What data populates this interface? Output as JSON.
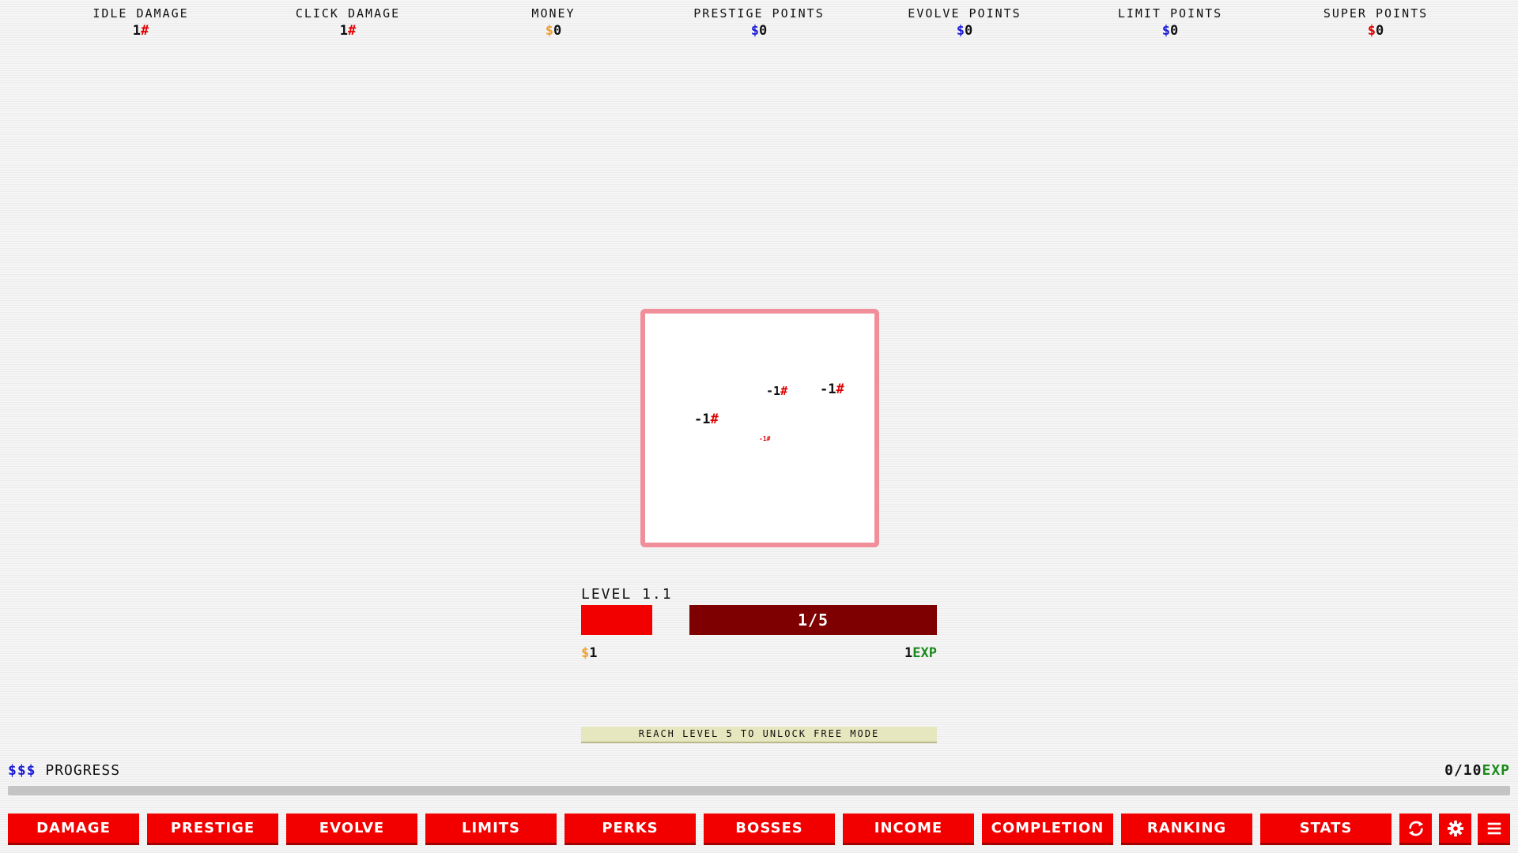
{
  "stats": [
    {
      "label": "IDLE DAMAGE",
      "value": "1",
      "symbol": "#",
      "symbol_color": "#e00000"
    },
    {
      "label": "CLICK DAMAGE",
      "value": "1",
      "symbol": "#",
      "symbol_color": "#e00000"
    },
    {
      "label": "MONEY",
      "value": "0",
      "symbol": "$",
      "symbol_color": "#f0a030"
    },
    {
      "label": "PRESTIGE POINTS",
      "value": "0",
      "symbol": "$",
      "symbol_color": "#1a1ad6"
    },
    {
      "label": "EVOLVE POINTS",
      "value": "0",
      "symbol": "$",
      "symbol_color": "#1a1ad6"
    },
    {
      "label": "LIMIT POINTS",
      "value": "0",
      "symbol": "$",
      "symbol_color": "#1a1ad6"
    },
    {
      "label": "SUPER POINTS",
      "value": "0",
      "symbol": "$",
      "symbol_color": "#e00000"
    }
  ],
  "enemy": {
    "border_color": "#f08e9a",
    "damage_popups": [
      {
        "text": "-1",
        "symbol": "#"
      },
      {
        "text": "-1",
        "symbol": "#"
      },
      {
        "text": "-1",
        "symbol": "#"
      },
      {
        "text": "-1",
        "symbol": "#"
      }
    ]
  },
  "level": {
    "title": "LEVEL 1.1",
    "kills_text": "1/5",
    "reward_money_symbol": "$",
    "reward_money": "1",
    "reward_exp": "1",
    "reward_exp_unit": "EXP"
  },
  "unlock_banner": "REACH LEVEL 5 TO UNLOCK FREE MODE",
  "progress": {
    "symbols": "$$$",
    "label": "PROGRESS",
    "value_text": "0/10",
    "unit": "EXP",
    "fraction": 0
  },
  "nav": {
    "tabs": [
      "DAMAGE",
      "PRESTIGE",
      "EVOLVE",
      "LIMITS",
      "PERKS",
      "BOSSES",
      "INCOME",
      "COMPLETION",
      "RANKING",
      "STATS"
    ],
    "icons": [
      "refresh-icon",
      "gear-icon",
      "menu-icon"
    ]
  },
  "colors": {
    "accent": "#f20000",
    "accent_dark": "#7e0000",
    "money": "#f0a030",
    "points_blue": "#1a1ad6",
    "exp_green": "#1a8a1a"
  }
}
